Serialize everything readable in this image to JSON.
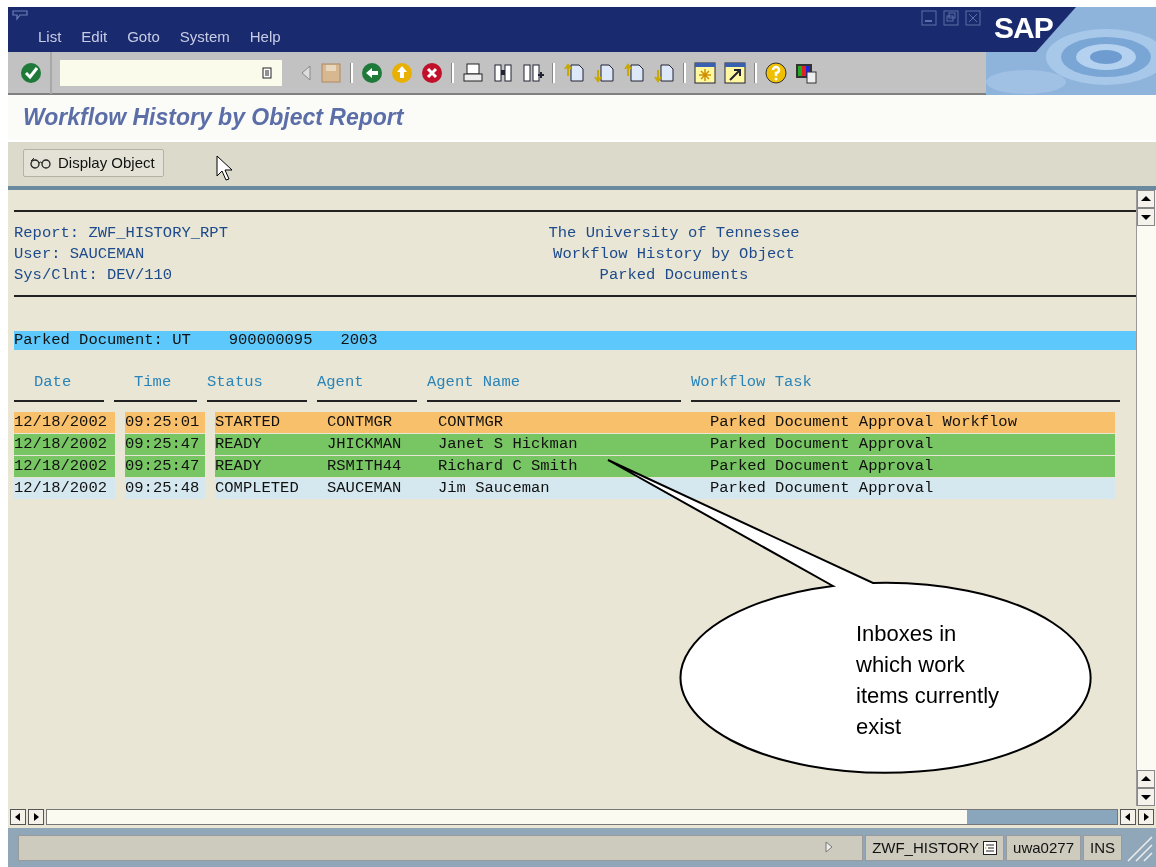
{
  "menu": [
    "List",
    "Edit",
    "Goto",
    "System",
    "Help"
  ],
  "logo": "SAP",
  "screen_title": "Workflow History by Object Report",
  "app_toolbar": {
    "button": "Display Object"
  },
  "report": {
    "left_header": [
      "Report: ZWF_HISTORY_RPT",
      "User: SAUCEMAN",
      "Sys/Clnt: DEV/110"
    ],
    "right_header": [
      "The University of Tennessee",
      "Workflow History by Object",
      "Parked Documents"
    ],
    "document_band": [
      "Parked Document: UT",
      "900000095",
      "2003"
    ],
    "columns": [
      "Date",
      "Time",
      "Status",
      "Agent",
      "Agent Name",
      "Workflow Task"
    ],
    "rows": [
      {
        "cells": [
          "12/18/2002",
          "09:25:01",
          "STARTED",
          "CONTMGR",
          "CONTMGR",
          "Parked Document Approval Workflow"
        ],
        "color": "#f9c06b"
      },
      {
        "cells": [
          "12/18/2002",
          "09:25:47",
          "READY",
          "JHICKMAN",
          "Janet S Hickman",
          "Parked Document Approval"
        ],
        "color": "#78c563"
      },
      {
        "cells": [
          "12/18/2002",
          "09:25:47",
          "READY",
          "RSMITH44",
          "Richard C Smith",
          "Parked Document Approval"
        ],
        "color": "#78c563"
      },
      {
        "cells": [
          "12/18/2002",
          "09:25:48",
          "COMPLETED",
          "SAUCEMAN",
          "Jim Sauceman",
          "Parked Document Approval"
        ],
        "color": "#d5e8f0"
      }
    ]
  },
  "callout": "Inboxes in which work items currently exist",
  "status_bar": {
    "transaction": "ZWF_HISTORY",
    "server": "uwa0277",
    "mode": "INS"
  }
}
